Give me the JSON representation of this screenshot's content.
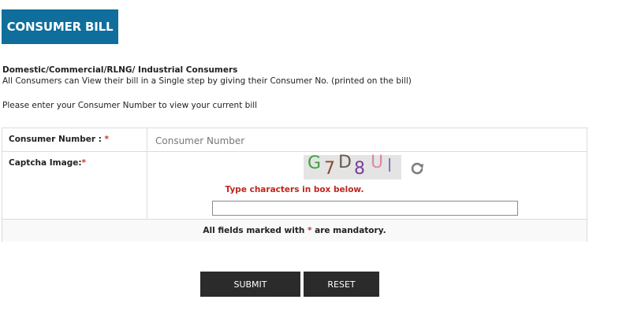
{
  "header": {
    "title": "CONSUMER BILL"
  },
  "intro": {
    "heading": "Domestic/Commercial/RLNG/ Industrial Consumers",
    "description": "All Consumers can View their bill in a Single step by giving their Consumer No. (printed on the bill)"
  },
  "prompt": "Please enter your Consumer Number to view your current bill",
  "form": {
    "consumer_number": {
      "label": "Consumer Number :",
      "required_mark": "*",
      "placeholder": "Consumer Number",
      "value": ""
    },
    "captcha": {
      "label": "Captcha Image:",
      "required_mark": "*",
      "characters": [
        "G",
        "7",
        "D",
        "8",
        "U",
        "l"
      ],
      "hint": "Type characters in box below.",
      "refresh_icon": "refresh-icon",
      "value": ""
    },
    "mandatory_note": {
      "before": "All fields marked with ",
      "mark": "*",
      "after": " are mandatory."
    }
  },
  "buttons": {
    "submit": "SUBMIT",
    "reset": "RESET"
  },
  "colors": {
    "header_bg": "#0f6e9c",
    "button_bg": "#2b2b2b",
    "required": "#c0392b",
    "hint": "#c0251b"
  }
}
